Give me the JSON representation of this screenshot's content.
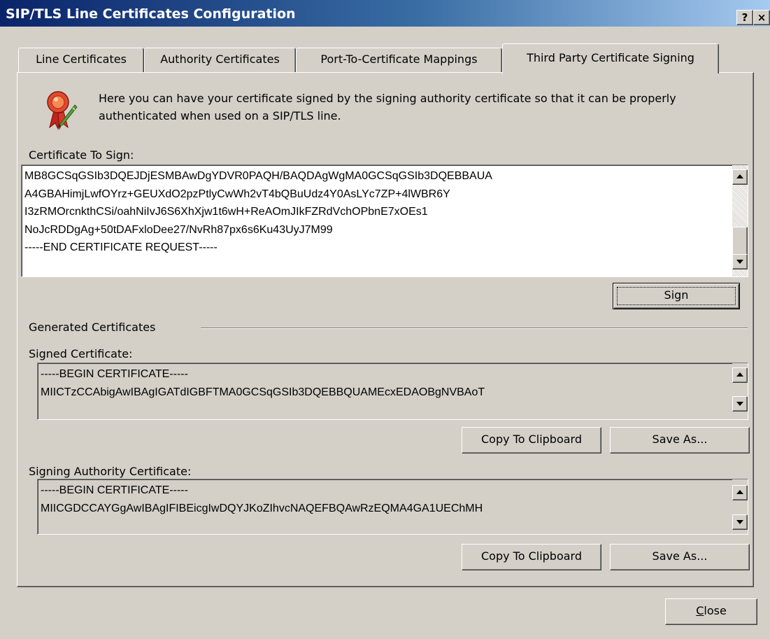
{
  "window": {
    "title": "SIP/TLS Line Certificates Configuration",
    "help_button": "?",
    "close_button": "×"
  },
  "tabs": [
    {
      "label": "Line Certificates",
      "active": false
    },
    {
      "label": "Authority Certificates",
      "active": false
    },
    {
      "label": "Port-To-Certificate Mappings",
      "active": false
    },
    {
      "label": "Third Party Certificate Signing",
      "active": true
    }
  ],
  "intro": {
    "icon": "certificate-ribbon-pen-icon",
    "text": "Here you can have your certificate signed by the signing authority certificate so that it can be properly authenticated when used on a SIP/TLS line."
  },
  "certificate_to_sign": {
    "label": "Certificate To Sign:",
    "text": "MB8GCSqGSIb3DQEJDjESMBAwDgYDVR0PAQH/BAQDAgWgMA0GCSqGSIb3DQEBBAUA\nA4GBAHimjLwfOYrz+GEUXdO2pzPtlyCwWh2vT4bQBuUdz4Y0AsLYc7ZP+4lWBR6Y\nI3zRMOrcnkthCSi/oahNiIvJ6S6XhXjw1t6wH+ReAOmJIkFZRdVchOPbnE7xOEs1\nNoJcRDDgAg+50tDAFxloDee27/NvRh87px6s6Ku43UyJ7M99\n-----END CERTIFICATE REQUEST-----",
    "sign_button": "Sign"
  },
  "generated": {
    "group_label": "Generated Certificates",
    "signed_certificate": {
      "label": "Signed Certificate:",
      "text": "-----BEGIN CERTIFICATE-----\nMIICTzCCAbigAwIBAgIGATdIGBFTMA0GCSqGSIb3DQEBBQUAMEcxEDAOBgNVBAoT",
      "copy_button": "Copy To Clipboard",
      "save_button": "Save As..."
    },
    "signing_authority_certificate": {
      "label": "Signing Authority Certificate:",
      "text": "-----BEGIN CERTIFICATE-----\nMIICGDCCAYGgAwIBAgIFIBEicgIwDQYJKoZIhvcNAQEFBQAwRzEQMA4GA1UEChMH",
      "copy_button": "Copy To Clipboard",
      "save_button": "Save As..."
    }
  },
  "footer": {
    "close_button": "Close",
    "close_mnemonic": "C",
    "close_rest": "lose"
  }
}
